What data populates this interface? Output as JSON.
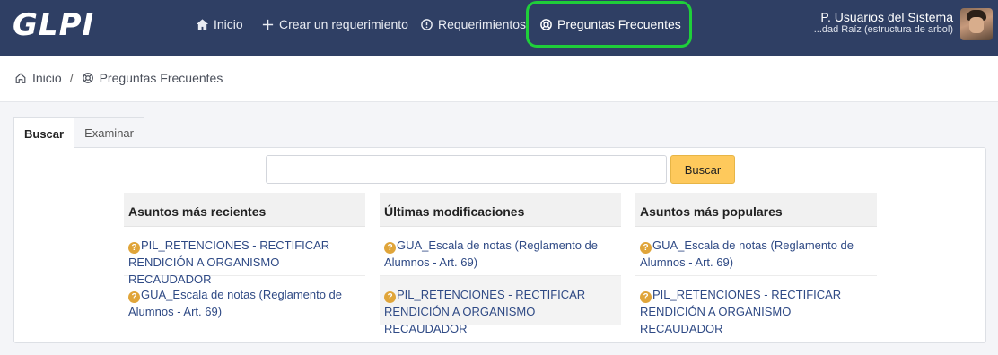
{
  "header": {
    "logo": "GLPI",
    "nav": [
      {
        "label": "Inicio",
        "icon": "home-icon"
      },
      {
        "label": "Crear un requerimiento",
        "icon": "plus-icon"
      },
      {
        "label": "Requerimientos",
        "icon": "alert-circle-icon"
      },
      {
        "label": "Preguntas Frecuentes",
        "icon": "lifebuoy-icon"
      }
    ],
    "highlight_color": "#1fcf3a",
    "user_name": "P. Usuarios del Sistema",
    "user_entity": "...dad Raíz (estructura de arbol)"
  },
  "breadcrumb": {
    "home": "Inicio",
    "separator": "/",
    "current": "Preguntas Frecuentes"
  },
  "tabs": [
    {
      "label": "Buscar",
      "active": true
    },
    {
      "label": "Examinar",
      "active": false
    }
  ],
  "search": {
    "value": "",
    "button_label": "Buscar",
    "button_color": "#fec95c"
  },
  "columns": [
    {
      "title": "Asuntos más recientes",
      "items": [
        "PIL_RETENCIONES - RECTIFICAR RENDICIÓN A ORGANISMO RECAUDADOR",
        "GUA_Escala de notas (Reglamento de Alumnos - Art. 69)"
      ]
    },
    {
      "title": "Últimas modificaciones",
      "items": [
        "GUA_Escala de notas (Reglamento de Alumnos - Art. 69)",
        "PIL_RETENCIONES - RECTIFICAR RENDICIÓN A ORGANISMO RECAUDADOR"
      ]
    },
    {
      "title": "Asuntos más populares",
      "items": [
        "GUA_Escala de notas (Reglamento de Alumnos - Art. 69)",
        "PIL_RETENCIONES - RECTIFICAR RENDICIÓN A ORGANISMO RECAUDADOR"
      ]
    }
  ],
  "colors": {
    "topbar": "#2f3f64",
    "link": "#2f4a85",
    "faq_icon": "#e0a53a"
  }
}
